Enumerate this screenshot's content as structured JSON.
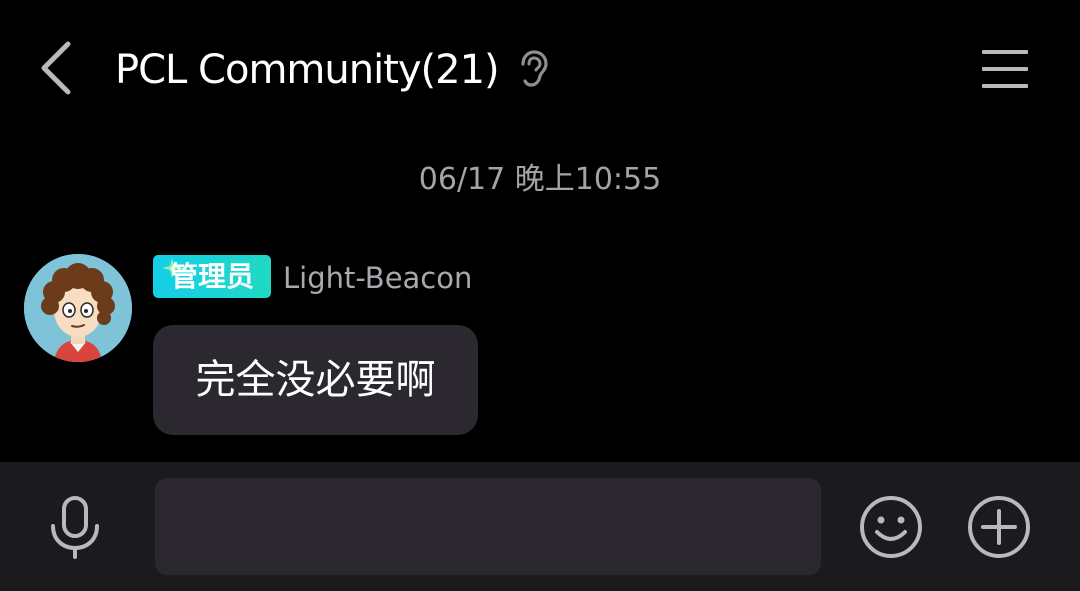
{
  "header": {
    "back_icon": "chevron-left-icon",
    "title": "PCL Community(21)",
    "ear_icon": "ear-icon",
    "menu_icon": "hamburger-menu-icon"
  },
  "chat": {
    "timestamp": "06/17 晚上10:55",
    "messages": [
      {
        "role_badge": "管理员",
        "sender": "Light-Beacon",
        "text": "完全没必要啊",
        "avatar_icon": "cartoon-avatar"
      }
    ]
  },
  "input_bar": {
    "mic_icon": "microphone-icon",
    "message_value": "",
    "emoji_icon": "smiley-icon",
    "add_icon": "plus-circle-icon"
  },
  "colors": {
    "background": "#000000",
    "bubble": "#2b292f",
    "input_bar": "#1b1b1d",
    "badge_start": "#14cfe6",
    "badge_end": "#1fd9c4",
    "secondary_text": "#a4a4a8"
  }
}
